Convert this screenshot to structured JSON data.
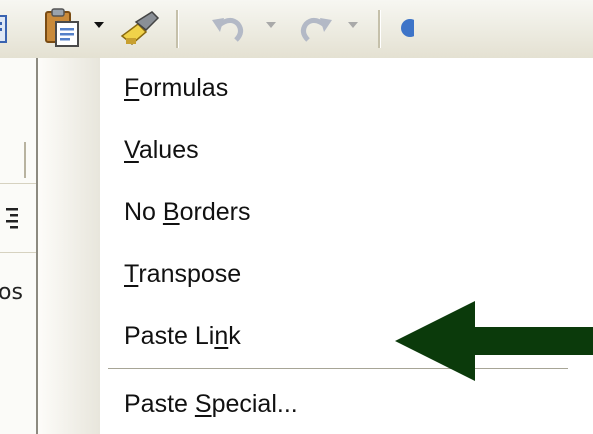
{
  "toolbar": {
    "buttons": [
      {
        "name": "paste-icon",
        "has_dropdown": true
      },
      {
        "name": "format-painter-icon",
        "has_dropdown": false
      },
      {
        "name": "undo-icon",
        "has_dropdown": true
      },
      {
        "name": "redo-icon",
        "has_dropdown": true
      }
    ]
  },
  "left_strip": {
    "partial_text": "os"
  },
  "paste_menu": {
    "items": [
      {
        "pre": "",
        "key": "F",
        "post": "ormulas"
      },
      {
        "pre": "",
        "key": "V",
        "post": "alues"
      },
      {
        "pre": "No ",
        "key": "B",
        "post": "orders"
      },
      {
        "pre": "",
        "key": "T",
        "post": "ranspose"
      },
      {
        "pre": "Paste Li",
        "key": "n",
        "post": "k"
      },
      {
        "pre": "Paste ",
        "key": "S",
        "post": "pecial..."
      }
    ]
  },
  "colors": {
    "arrow": "#0b3a0b",
    "toolbar_bg": "#ece9d8",
    "menu_bg": "#ffffff"
  }
}
